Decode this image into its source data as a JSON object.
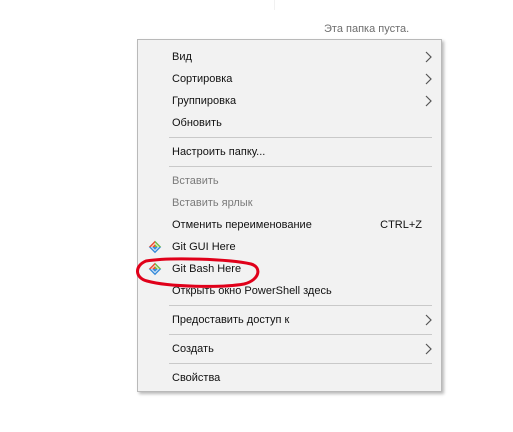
{
  "folder": {
    "empty_text": "Эта папка пуста."
  },
  "menu": {
    "view": "Вид",
    "sort": "Сортировка",
    "group": "Группировка",
    "refresh": "Обновить",
    "customize": "Настроить папку...",
    "paste": "Вставить",
    "paste_shortcut": "Вставить ярлык",
    "undo_rename": "Отменить переименование",
    "undo_shortcut": "CTRL+Z",
    "git_gui": "Git GUI Here",
    "git_bash": "Git Bash Here",
    "powershell": "Открыть окно PowerShell здесь",
    "share_with": "Предоставить доступ к",
    "create": "Создать",
    "properties": "Свойства"
  },
  "icons": {
    "submenu": "chevron-right-icon",
    "git": "git-logo-icon"
  },
  "colors": {
    "menu_background": "#f2f2f2",
    "highlight": "#e0001a",
    "git_red": "#f05033",
    "git_green": "#7bbf43",
    "git_blue": "#3c8edb"
  }
}
